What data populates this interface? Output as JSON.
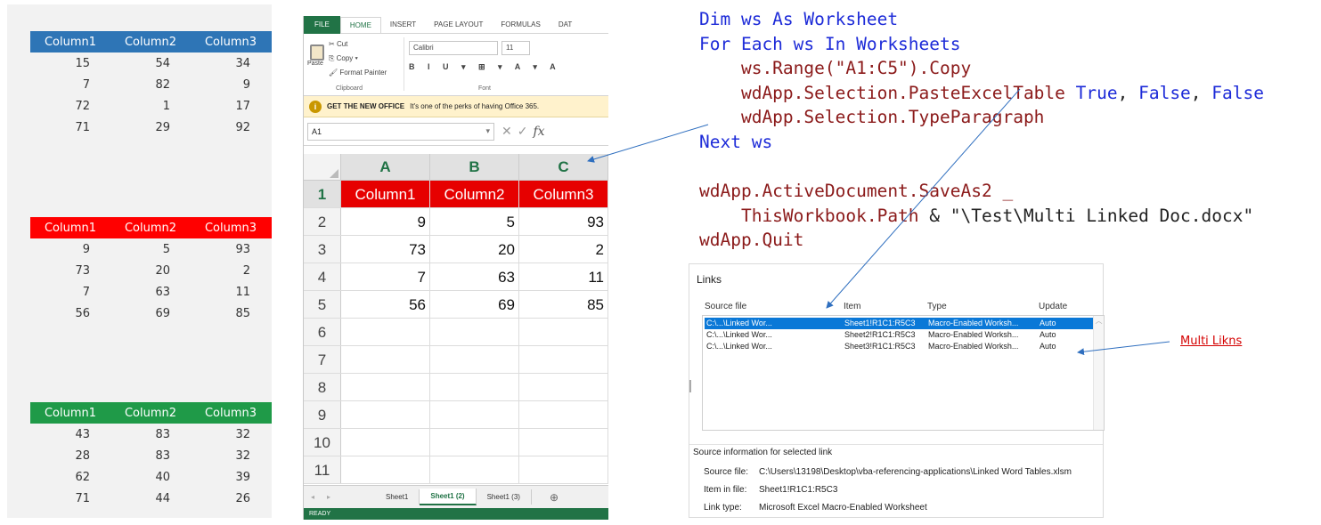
{
  "tables": [
    {
      "color": "#2e75b6",
      "headers": [
        "Column1",
        "Column2",
        "Column3"
      ],
      "rows": [
        [
          "15",
          "54",
          "34"
        ],
        [
          "7",
          "82",
          "9"
        ],
        [
          "72",
          "1",
          "17"
        ],
        [
          "71",
          "29",
          "92"
        ]
      ]
    },
    {
      "color": "#ff0000",
      "headers": [
        "Column1",
        "Column2",
        "Column3"
      ],
      "rows": [
        [
          "9",
          "5",
          "93"
        ],
        [
          "73",
          "20",
          "2"
        ],
        [
          "7",
          "63",
          "11"
        ],
        [
          "56",
          "69",
          "85"
        ]
      ]
    },
    {
      "color": "#1f9a48",
      "headers": [
        "Column1",
        "Column2",
        "Column3"
      ],
      "rows": [
        [
          "43",
          "83",
          "32"
        ],
        [
          "28",
          "83",
          "32"
        ],
        [
          "62",
          "40",
          "39"
        ],
        [
          "71",
          "44",
          "26"
        ]
      ]
    }
  ],
  "excel": {
    "tabs": [
      "FILE",
      "HOME",
      "INSERT",
      "PAGE LAYOUT",
      "FORMULAS",
      "DAT"
    ],
    "clipboard": {
      "paste": "Paste",
      "cut": "Cut",
      "copy": "Copy",
      "format_painter": "Format Painter",
      "label": "Clipboard"
    },
    "font": {
      "name": "Calibri",
      "size": "11",
      "label": "Font"
    },
    "notice": {
      "title": "GET THE NEW OFFICE",
      "text": "It's one of the perks of having Office 365."
    },
    "name_box": "A1",
    "col_headers": [
      "A",
      "B",
      "C"
    ],
    "row_numbers": [
      "1",
      "2",
      "3",
      "4",
      "5",
      "6",
      "7",
      "8",
      "9",
      "10",
      "11"
    ],
    "header_row": [
      "Column1",
      "Column2",
      "Column3"
    ],
    "data_rows": [
      [
        "9",
        "5",
        "93"
      ],
      [
        "73",
        "20",
        "2"
      ],
      [
        "7",
        "63",
        "11"
      ],
      [
        "56",
        "69",
        "85"
      ]
    ],
    "sheet_tabs": [
      "Sheet1",
      "Sheet1 (2)",
      "Sheet1 (3)"
    ],
    "status": "READY"
  },
  "code": {
    "l1": "Dim ws As Worksheet",
    "l2": "For Each ws In Worksheets",
    "l3": "    ws.Range(\"A1:C5\").Copy",
    "l4a": "    wdApp.Selection.PasteExcelTable ",
    "l4b": "True",
    "l4c": ", ",
    "l4d": "False",
    "l4e": ", ",
    "l4f": "False",
    "l5": "    wdApp.Selection.TypeParagraph",
    "l6": "Next ws",
    "l7": "",
    "l8": "wdApp.ActiveDocument.SaveAs2 _",
    "l9a": "    ThisWorkbook.Path ",
    "l9b": "& \"\\Test\\Multi Linked Doc.docx\"",
    "l10": "wdApp.Quit"
  },
  "links_dialog": {
    "title": "Links",
    "headers": {
      "source": "Source file",
      "item": "Item",
      "type": "Type",
      "update": "Update"
    },
    "rows": [
      {
        "source": "C:\\...\\Linked Wor...",
        "item": "Sheet1!R1C1:R5C3",
        "type": "Macro-Enabled Worksh...",
        "update": "Auto"
      },
      {
        "source": "C:\\...\\Linked Wor...",
        "item": "Sheet2!R1C1:R5C3",
        "type": "Macro-Enabled Worksh...",
        "update": "Auto"
      },
      {
        "source": "C:\\...\\Linked Wor...",
        "item": "Sheet3!R1C1:R5C3",
        "type": "Macro-Enabled Worksh...",
        "update": "Auto"
      }
    ],
    "info_title": "Source information for selected link",
    "source_file_label": "Source file:",
    "source_file": "C:\\Users\\13198\\Desktop\\vba-referencing-applications\\Linked Word Tables.xlsm",
    "item_label": "Item in file:",
    "item": "Sheet1!R1C1:R5C3",
    "link_type_label": "Link type:",
    "link_type": "Microsoft Excel Macro-Enabled Worksheet"
  },
  "annotation": "Multi Likns",
  "colors": {
    "code_keyword": "#1d2bd8",
    "code_text": "#8b1a1a",
    "excel_green": "#217346",
    "annotation": "#d40000"
  }
}
